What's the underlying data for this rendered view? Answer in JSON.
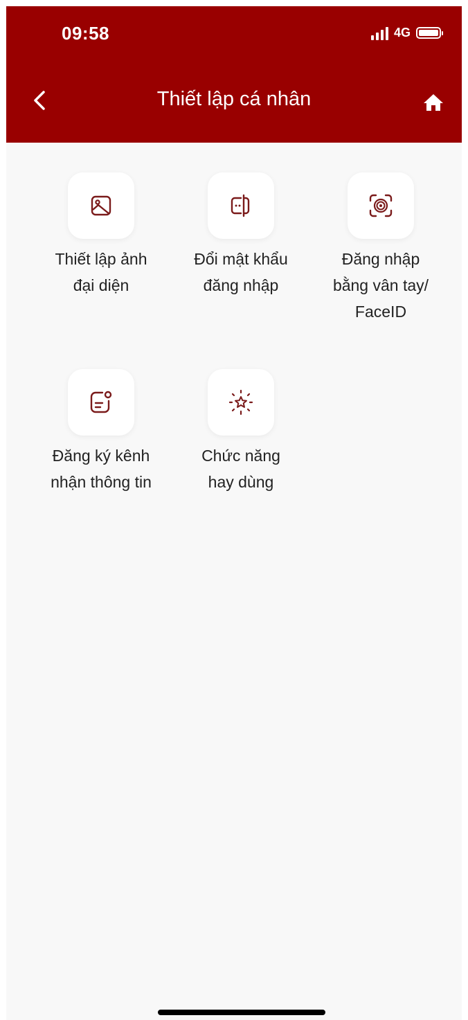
{
  "status_bar": {
    "time": "09:58",
    "network": "4G",
    "signal_icon": "signal-bars-icon",
    "battery_icon": "battery-icon"
  },
  "header": {
    "title": "Thiết lập cá nhân",
    "back_icon": "chevron-left-icon",
    "home_icon": "home-icon"
  },
  "colors": {
    "brand": "#990000",
    "background": "#f8f8f8",
    "tile": "#ffffff",
    "icon": "#7a1a1a"
  },
  "menu": {
    "items": [
      {
        "label": "Thiết lập ảnh\nđại diện",
        "icon": "image-icon"
      },
      {
        "label": "Đổi mật khẩu\nđăng nhập",
        "icon": "password-icon"
      },
      {
        "label": "Đăng nhập\nbằng vân tay/\nFaceID",
        "icon": "face-id-icon"
      },
      {
        "label": "Đăng ký kênh\nnhận thông tin",
        "icon": "notification-channel-icon"
      },
      {
        "label": "Chức năng\nhay dùng",
        "icon": "favorite-star-icon"
      }
    ]
  }
}
